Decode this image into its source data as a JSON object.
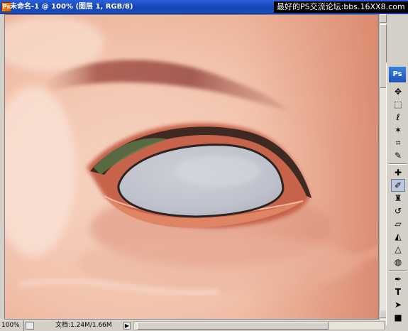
{
  "window": {
    "title": "未命名-1 @ 100% (图层 1, RGB/8)",
    "app_icon_label": "Ps"
  },
  "watermark": {
    "text": "最好的PS交流论坛:bbs.16XX8.com"
  },
  "toolbox": {
    "logo": "Ps",
    "tools": [
      {
        "name": "move",
        "glyph": "✥"
      },
      {
        "name": "marquee",
        "glyph": "⬚"
      },
      {
        "name": "lasso",
        "glyph": "ℓ"
      },
      {
        "name": "magic-wand",
        "glyph": "✶"
      },
      {
        "name": "crop",
        "glyph": "⌗"
      },
      {
        "name": "slice",
        "glyph": "✎"
      },
      {
        "name": "healing",
        "glyph": "✚"
      },
      {
        "name": "brush",
        "glyph": "✐"
      },
      {
        "name": "stamp",
        "glyph": "♜"
      },
      {
        "name": "history-brush",
        "glyph": "↺"
      },
      {
        "name": "eraser",
        "glyph": "▱"
      },
      {
        "name": "paint-bucket",
        "glyph": "◭"
      },
      {
        "name": "blur",
        "glyph": "△"
      },
      {
        "name": "dodge",
        "glyph": "◍"
      },
      {
        "name": "pen",
        "glyph": "✒"
      },
      {
        "name": "type",
        "glyph": "T"
      },
      {
        "name": "path-select",
        "glyph": "➤"
      },
      {
        "name": "shape",
        "glyph": "■"
      },
      {
        "name": "notes",
        "glyph": "▤"
      },
      {
        "name": "eyedropper",
        "glyph": "⁄"
      },
      {
        "name": "hand",
        "glyph": "✋"
      }
    ],
    "active_tool": "brush"
  },
  "statusbar": {
    "zoom": "100%",
    "doc_size": "文档:1.24M/1.66M",
    "arrow": "▶"
  },
  "colors": {
    "title_bar": "#1745b6",
    "chrome": "#d4d0c8",
    "skin_light": "#f6d3c2",
    "skin_shadow": "#d98a6e",
    "eyeball": "#c7c9d0"
  }
}
